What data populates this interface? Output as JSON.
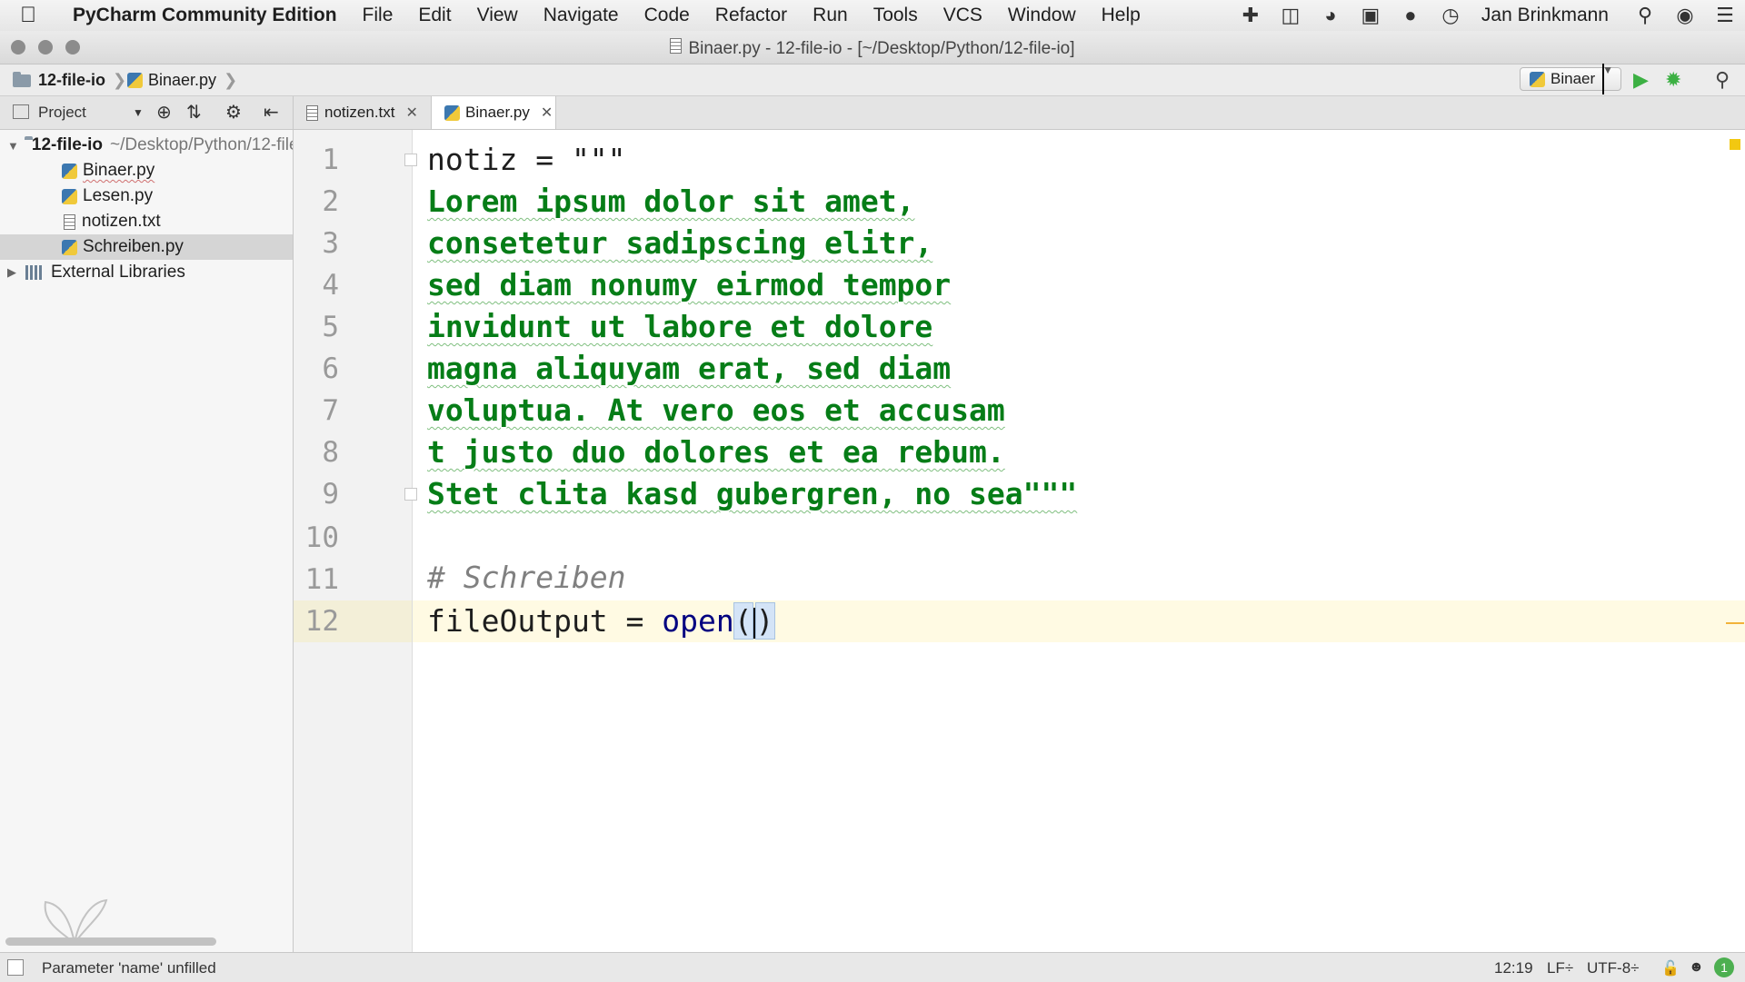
{
  "menubar": {
    "app_name": "PyCharm Community Edition",
    "items": [
      "File",
      "Edit",
      "View",
      "Navigate",
      "Code",
      "Refactor",
      "Run",
      "Tools",
      "VCS",
      "Window",
      "Help"
    ],
    "user": "Jan Brinkmann"
  },
  "window": {
    "title": "Binaer.py - 12-file-io - [~/Desktop/Python/12-file-io]"
  },
  "navbar": {
    "crumb_project": "12-file-io",
    "crumb_file": "Binaer.py",
    "run_config": "Binaer"
  },
  "project_panel": {
    "label": "Project"
  },
  "tabs": [
    {
      "label": "notizen.txt",
      "active": false
    },
    {
      "label": "Binaer.py",
      "active": true
    }
  ],
  "tree": {
    "root_name": "12-file-io",
    "root_path": "~/Desktop/Python/12-file-io",
    "files": [
      "Binaer.py",
      "Lesen.py",
      "notizen.txt",
      "Schreiben.py"
    ],
    "selected": "Schreiben.py",
    "external": "External Libraries"
  },
  "editor": {
    "line_numbers": [
      "1",
      "2",
      "3",
      "4",
      "5",
      "6",
      "7",
      "8",
      "9",
      "10",
      "11",
      "12"
    ],
    "current_line": 12,
    "lines": [
      "notiz = \"\"\"",
      "Lorem ipsum dolor sit amet,",
      "consetetur sadipscing elitr,",
      "sed diam nonumy eirmod tempor",
      "invidunt ut labore et dolore",
      "magna aliquyam erat, sed diam",
      "voluptua. At vero eos et accusam",
      "t justo duo dolores et ea rebum.",
      "Stet clita kasd gubergren, no sea\"\"\"",
      "",
      "# Schreiben",
      "fileOutput = open()"
    ]
  },
  "statusbar": {
    "message": "Parameter 'name' unfilled",
    "position": "12:19",
    "line_sep": "LF÷",
    "encoding": "UTF-8÷",
    "notifications": "1"
  },
  "colors": {
    "string": "#067d17",
    "comment": "#808080",
    "builtin": "#000080",
    "current_line": "#fffae3",
    "run_green": "#3cb043"
  }
}
